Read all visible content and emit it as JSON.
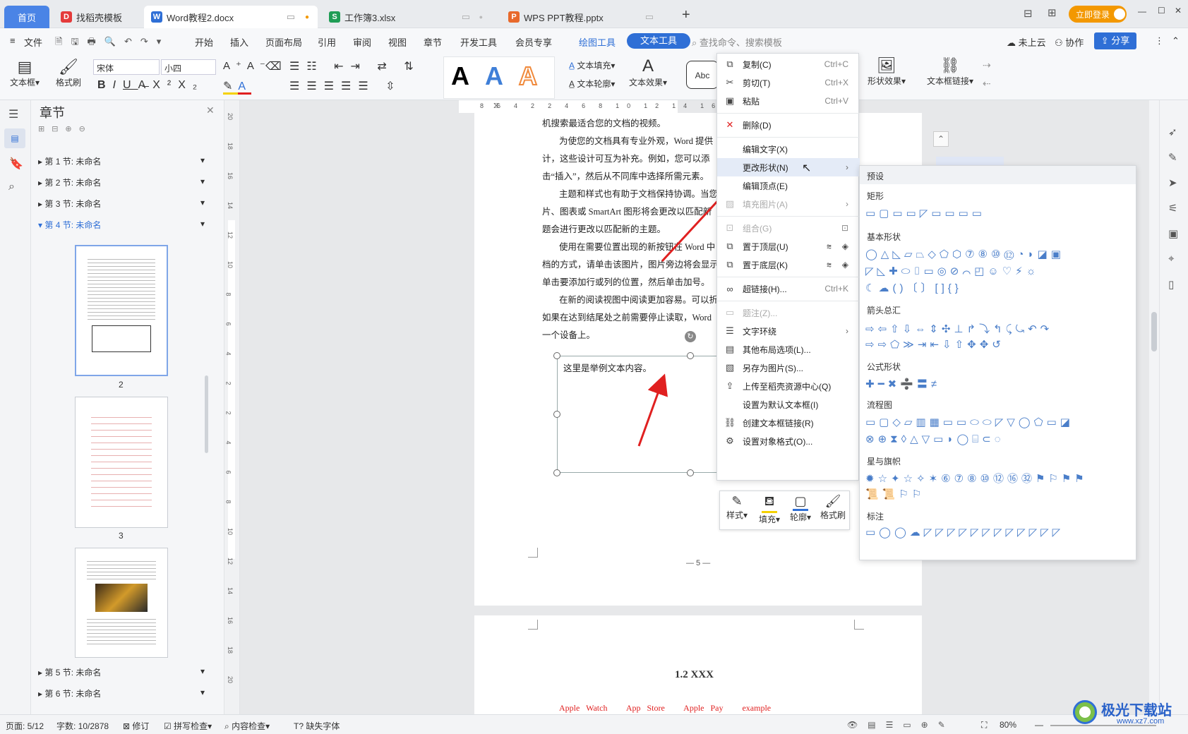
{
  "tabs": {
    "home": "首页",
    "t1": "找稻壳模板",
    "t2": "Word教程2.docx",
    "t3": "工作簿3.xlsx",
    "t4": "WPS PPT教程.pptx",
    "login": "立即登录"
  },
  "menu": {
    "file": "文件",
    "items": [
      "开始",
      "插入",
      "页面布局",
      "引用",
      "审阅",
      "视图",
      "章节",
      "开发工具",
      "会员专享",
      "绘图工具",
      "文本工具"
    ],
    "search_placeholder": "查找命令、搜索模板",
    "cloud": "未上云",
    "collab": "协作",
    "share": "分享"
  },
  "ribbon": {
    "textbox": "文本框",
    "format_painter": "格式刷",
    "font": "宋体",
    "size": "小四",
    "text_fill": "文本填充",
    "text_outline": "文本轮廓",
    "text_effect": "文本效果",
    "shape_effect": "形状效果",
    "textbox_link": "文本框链接",
    "abc": "Abc"
  },
  "nav": {
    "title": "章节",
    "sections": [
      "第 1 节: 未命名",
      "第 2 节: 未命名",
      "第 3 节: 未命名",
      "第 4 节: 未命名",
      "第 5 节: 未命名",
      "第 6 节: 未命名"
    ],
    "pages": [
      "2",
      "3"
    ]
  },
  "ruler": [
    "8",
    "6",
    "4",
    "2",
    "2",
    "4",
    "6",
    "8",
    "10",
    "12",
    "14",
    "16",
    "34",
    "36",
    "38"
  ],
  "vruler": [
    "20",
    "18",
    "16",
    "14",
    "12",
    "10",
    "8",
    "6",
    "4",
    "2",
    "2",
    "4",
    "6",
    "8",
    "10",
    "12",
    "14",
    "16",
    "18",
    "20"
  ],
  "doc": {
    "lines": [
      "机搜索最适合您的文档的视频。",
      "为使您的文档具有专业外观，Word 提供",
      "计，这些设计可互为补充。例如，您可以添",
      "击“插入”，然后从不同库中选择所需元素。",
      "主题和样式也有助于文档保持协调。当您",
      "片、图表或 SmartArt 图形将会更改以匹配新",
      "题会进行更改以匹配新的主题。",
      "使用在需要位置出现的新按钮在 Word 中",
      "档的方式，请单击该图片，图片旁边将会显示",
      "单击要添加行或列的位置，然后单击加号。",
      "在新的阅读视图中阅读更加容易。可以折",
      "如果在达到结尾处之前需要停止读取，Word",
      "一个设备上。"
    ],
    "textbox": "这里是举例文本内容。",
    "page_no": "— 5 —",
    "heading2": "1.2 XXX",
    "red_line": [
      "Apple Watch",
      "App Store",
      "Apple Pay",
      "example"
    ]
  },
  "context_menu": [
    {
      "label": "复制(C)",
      "shortcut": "Ctrl+C",
      "icon": "copy-icon",
      "glyph": "⧉"
    },
    {
      "label": "剪切(T)",
      "shortcut": "Ctrl+X",
      "icon": "scissors-icon",
      "glyph": "✂"
    },
    {
      "label": "粘贴",
      "shortcut": "Ctrl+V",
      "icon": "paste-icon",
      "glyph": "📋"
    },
    {
      "label": "删除(D)",
      "shortcut": "",
      "icon": "delete-icon",
      "glyph": "✕"
    },
    {
      "label": "编辑文字(X)",
      "shortcut": "",
      "icon": "",
      "glyph": ""
    },
    {
      "label": "更改形状(N)",
      "shortcut": "",
      "icon": "",
      "glyph": ""
    },
    {
      "label": "编辑顶点(E)",
      "shortcut": "",
      "icon": "",
      "glyph": ""
    },
    {
      "label": "填充图片(A)",
      "shortcut": "",
      "icon": "fill-image-icon",
      "glyph": "▨"
    },
    {
      "label": "组合(G)",
      "shortcut": "",
      "icon": "group-icon",
      "glyph": "⊡"
    },
    {
      "label": "置于顶层(U)",
      "shortcut": "",
      "icon": "bring-front-icon",
      "glyph": "⧉"
    },
    {
      "label": "置于底层(K)",
      "shortcut": "",
      "icon": "send-back-icon",
      "glyph": "⧉"
    },
    {
      "label": "超链接(H)...",
      "shortcut": "Ctrl+K",
      "icon": "link-icon",
      "glyph": "🔗"
    },
    {
      "label": "题注(Z)...",
      "shortcut": "",
      "icon": "caption-icon",
      "glyph": "▭"
    },
    {
      "label": "文字环绕",
      "shortcut": "",
      "icon": "wrap-icon",
      "glyph": "☰"
    },
    {
      "label": "其他布局选项(L)...",
      "shortcut": "",
      "icon": "layout-icon",
      "glyph": "▤"
    },
    {
      "label": "另存为图片(S)...",
      "shortcut": "",
      "icon": "save-image-icon",
      "glyph": "🖼"
    },
    {
      "label": "上传至稻壳资源中心(Q)",
      "shortcut": "",
      "icon": "upload-icon",
      "glyph": "⇪"
    },
    {
      "label": "设置为默认文本框(I)",
      "shortcut": "",
      "icon": "",
      "glyph": ""
    },
    {
      "label": "创建文本框链接(R)",
      "shortcut": "",
      "icon": "textlink-icon",
      "glyph": "⛓"
    },
    {
      "label": "设置对象格式(O)...",
      "shortcut": "",
      "icon": "format-icon",
      "glyph": "⚙"
    }
  ],
  "shape_panel": {
    "preset": "预设",
    "categories": [
      "矩形",
      "基本形状",
      "箭头总汇",
      "公式形状",
      "流程图",
      "星与旗帜",
      "标注"
    ]
  },
  "mini_toolbar": [
    "样式",
    "填充",
    "轮廓",
    "格式刷"
  ],
  "status": {
    "page": "页面: 5/12",
    "words": "字数: 10/2878",
    "revise": "修订",
    "spell": "拼写检查",
    "content": "内容检查",
    "font_missing": "缺失字体",
    "zoom": "80%"
  },
  "watermark": "极光下载站",
  "watermark_url": "www.xz7.com",
  "colors": {
    "accent": "#2f6fd6",
    "red": "#e02020",
    "wps_red": "#e43a3a",
    "orange": "#f39800"
  }
}
